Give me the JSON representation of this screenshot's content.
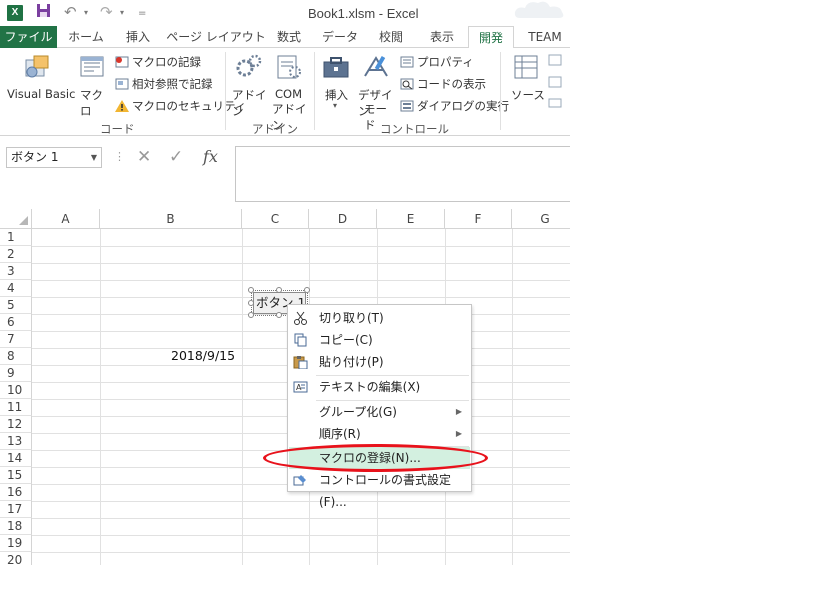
{
  "title": "Book1.xlsm - Excel",
  "tabs": [
    "ファイル",
    "ホーム",
    "挿入",
    "ページ レイアウト",
    "数式",
    "データ",
    "校閲",
    "表示",
    "開発",
    "TEAM"
  ],
  "ribbon": {
    "code": {
      "visual_basic": "Visual Basic",
      "macro": "マクロ",
      "record": "マクロの記録",
      "relative": "相対参照で記録",
      "security": "マクロのセキュリティ",
      "label": "コード"
    },
    "addins": {
      "addin": "アドイン",
      "com_line1": "COM",
      "com_line2": "アドイン",
      "label": "アドイン"
    },
    "controls": {
      "insert": "挿入",
      "design_line1": "デザイン",
      "design_line2": "モード",
      "properties": "プロパティ",
      "view_code": "コードの表示",
      "dialog": "ダイアログの実行",
      "label": "コントロール"
    },
    "xml": {
      "source": "ソース"
    }
  },
  "namebox": "ボタン 1",
  "fx_label": "fx",
  "columns": [
    "A",
    "B",
    "C",
    "D",
    "E",
    "F",
    "G"
  ],
  "rows": [
    "1",
    "2",
    "3",
    "4",
    "5",
    "6",
    "7",
    "8",
    "9",
    "10",
    "11",
    "12",
    "13",
    "14",
    "15",
    "16",
    "17",
    "18",
    "19",
    "20"
  ],
  "cell_b8": "2018/9/15",
  "form_button": "ボタン 1",
  "context_menu": [
    {
      "label": "切り取り(T)",
      "icon": "scissors-icon"
    },
    {
      "label": "コピー(C)",
      "icon": "copy-icon"
    },
    {
      "label": "貼り付け(P)",
      "icon": "paste-icon"
    },
    {
      "label": "テキストの編集(X)",
      "icon": "edit-text-icon"
    },
    {
      "label": "グループ化(G)",
      "icon": "",
      "submenu": true
    },
    {
      "label": "順序(R)",
      "icon": "",
      "submenu": true
    },
    {
      "label": "マクロの登録(N)...",
      "icon": "",
      "highlighted": true
    },
    {
      "label": "コントロールの書式設定(F)...",
      "icon": "format-control-icon"
    }
  ],
  "colors": {
    "excel_green": "#217346",
    "highlight": "#d3f0e0",
    "annotation_red": "#e8121b"
  }
}
